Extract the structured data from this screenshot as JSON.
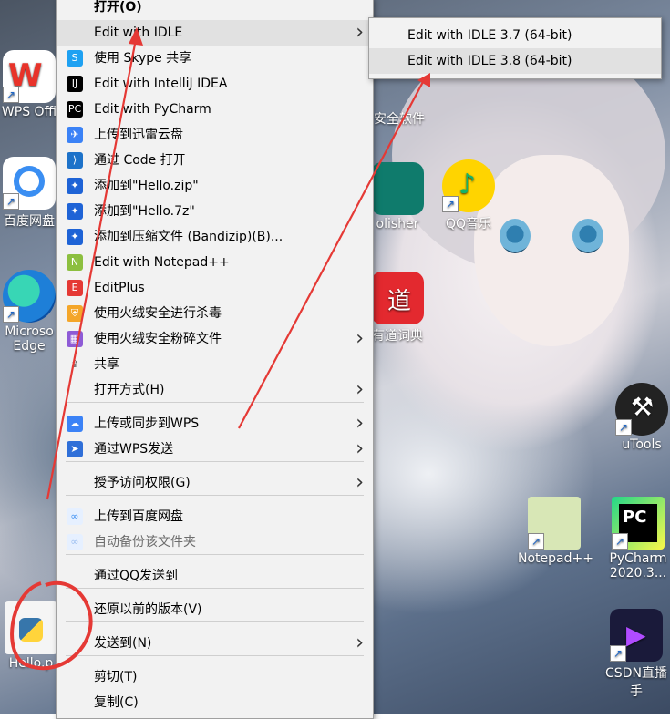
{
  "desktop": {
    "icons": [
      {
        "label": "WPS Offi",
        "icon": "wps-icon"
      },
      {
        "label": "百度网盘",
        "icon": "baidu-netdisk-icon"
      },
      {
        "label": "Microso Edge",
        "icon": "edge-icon"
      },
      {
        "label": "Hello.p",
        "icon": "python-file-icon"
      },
      {
        "label": "安全软件",
        "icon": "security-software-icon"
      },
      {
        "label": "olisher",
        "icon": "publisher-icon"
      },
      {
        "label": "QQ音乐",
        "icon": "qq-music-icon"
      },
      {
        "label": "有道词典",
        "icon": "youdao-icon"
      },
      {
        "label": "uTools",
        "icon": "utools-icon"
      },
      {
        "label": "Notepad++",
        "icon": "notepadpp-icon"
      },
      {
        "label": "PyCharm 2020.3...",
        "icon": "pycharm-icon"
      },
      {
        "label": "CSDN直播 手",
        "icon": "csdn-live-icon"
      }
    ]
  },
  "menu": {
    "items": [
      {
        "label": "打开(O)",
        "bold": true
      },
      {
        "label": "Edit with IDLE",
        "submenu": true,
        "highlighted": true
      },
      {
        "label": "使用 Skype 共享"
      },
      {
        "label": "Edit with IntelliJ IDEA"
      },
      {
        "label": "Edit with PyCharm"
      },
      {
        "label": "上传到迅雷云盘"
      },
      {
        "label": "通过 Code 打开"
      },
      {
        "label": "添加到\"Hello.zip\""
      },
      {
        "label": "添加到\"Hello.7z\""
      },
      {
        "label": "添加到压缩文件 (Bandizip)(B)..."
      },
      {
        "label": "Edit with Notepad++"
      },
      {
        "label": "EditPlus"
      },
      {
        "label": "使用火绒安全进行杀毒"
      },
      {
        "label": "使用火绒安全粉碎文件",
        "submenu": true
      },
      {
        "label": "共享"
      },
      {
        "label": "打开方式(H)",
        "submenu": true
      },
      {
        "label": "上传或同步到WPS",
        "submenu": true
      },
      {
        "label": "通过WPS发送",
        "submenu": true
      },
      {
        "label": "授予访问权限(G)",
        "submenu": true
      },
      {
        "label": "上传到百度网盘"
      },
      {
        "label": "自动备份该文件夹"
      },
      {
        "label": "通过QQ发送到"
      },
      {
        "label": "还原以前的版本(V)"
      },
      {
        "label": "发送到(N)",
        "submenu": true
      },
      {
        "label": "剪切(T)"
      },
      {
        "label": "复制(C)"
      }
    ]
  },
  "submenu": {
    "items": [
      {
        "label": "Edit with IDLE 3.7 (64-bit)"
      },
      {
        "label": "Edit with IDLE 3.8 (64-bit)",
        "highlighted": true
      }
    ]
  },
  "colors": {
    "menu_bg": "#f2f2f2",
    "highlight": "#e1e1e1",
    "annotation_red": "#e53935"
  }
}
